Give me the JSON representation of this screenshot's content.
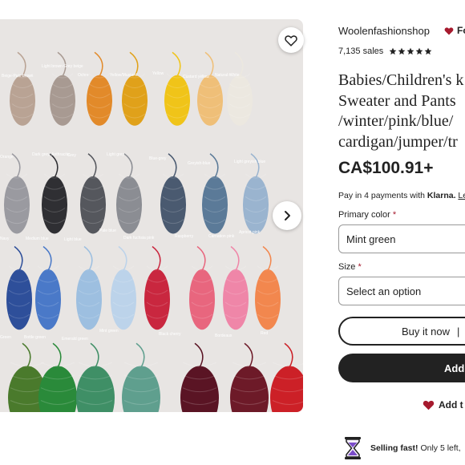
{
  "listing_photo": {
    "yarn_labels": [
      "Beige-Pale brown",
      "Light brown Grey beige",
      "Ochre",
      "Yellow/Mustard",
      "Yellow",
      "Custard yellow",
      "Natural-White",
      "Orange",
      "Dark grey/ Anthracite",
      "Grey",
      "Light grey",
      "Blue-grey",
      "Greyish-blue",
      "Light greyish blue",
      "Navy",
      "Medium blue",
      "Light blue",
      "Pale blue",
      "Dark fuchsia pink",
      "Raspberry",
      "Carnation pink",
      "Apricot pink",
      "Green",
      "Bottle green",
      "Emerald green",
      "Mint green",
      "Black cherry",
      "Bordeaux",
      "Red"
    ]
  },
  "favorite_icon": "heart-outline-icon",
  "next_icon": "chevron-right-icon",
  "shop": {
    "name": "Woolenfashionshop",
    "follow_label": "Fo",
    "sales": "7,135 sales",
    "rating": 5
  },
  "product": {
    "title_lines": [
      "Babies/Children's k",
      "Sweater and Pants",
      "/winter/pink/blue/",
      "cardigan/jumper/tr"
    ],
    "price": "CA$100.91+",
    "klarna": {
      "prefix": "Pay in 4 payments with",
      "brand": "Klarna.",
      "link": "Le"
    }
  },
  "options": {
    "primary_color_label": "Primary color",
    "primary_color_value": "Mint green",
    "size_label": "Size",
    "size_placeholder": "Select an option",
    "required_mark": "*"
  },
  "actions": {
    "buy_now": "Buy it now",
    "buy_divider": "|",
    "add_to_cart": "Add",
    "add_to_collection": "Add t"
  },
  "notice": {
    "bold": "Selling fast!",
    "text": "Only 5 left,"
  },
  "colors": {
    "accent_red": "#a61a2e",
    "dark_button": "#222222",
    "star": "#222222"
  }
}
